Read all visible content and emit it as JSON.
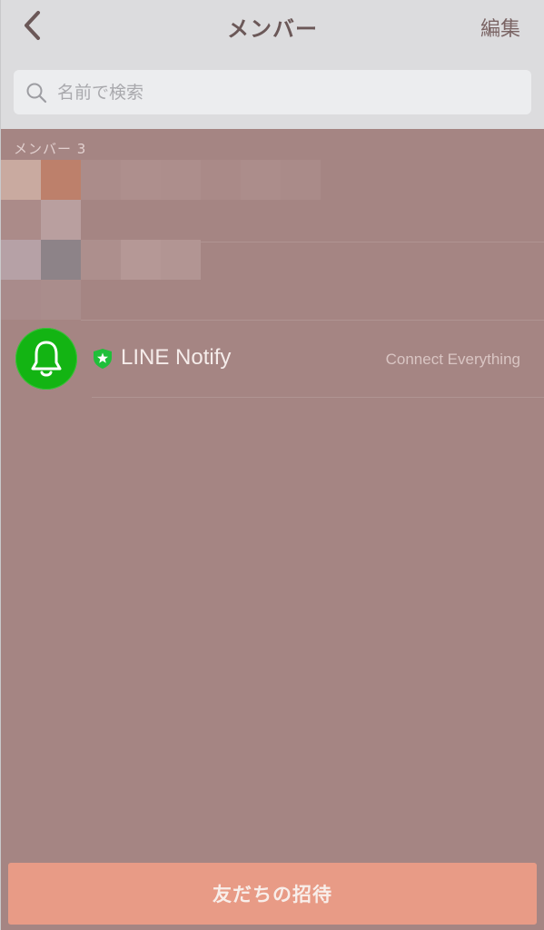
{
  "header": {
    "title": "メンバー",
    "edit_label": "編集"
  },
  "search": {
    "placeholder": "名前で検索"
  },
  "members_section": {
    "label": "メンバー 3"
  },
  "members": [
    {
      "name": "LINE Notify",
      "status": "Connect Everything",
      "avatar_icon": "bell-icon",
      "badge_icon": "official-star-shield-icon",
      "avatar_color": "#13b413"
    }
  ],
  "footer": {
    "invite_label": "友だちの招待"
  },
  "colors": {
    "navbar": "#dcdcde",
    "background": "#a58583",
    "invite_button": "#e89b86",
    "line_green": "#13b413"
  }
}
